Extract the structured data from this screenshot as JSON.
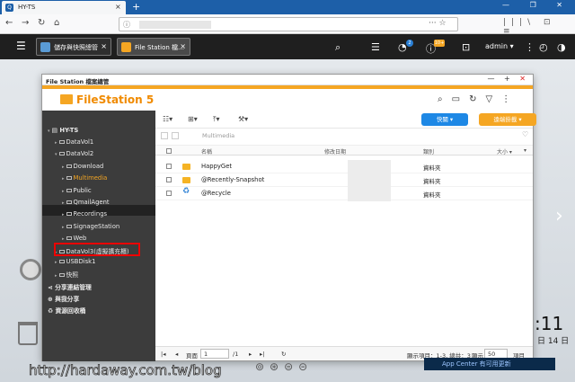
{
  "browser": {
    "tab_title": "HY-TS",
    "tab_icon": "Q",
    "tab_close": "×",
    "new_tab": "+",
    "window_controls": "— ❐ ✕",
    "url_info": "ⓘ",
    "url_dots": "··· ☆",
    "nav_right": "|||\\ ⊡ ≡"
  },
  "qts": {
    "tabs": [
      {
        "label": "儲存與快照總管",
        "close": "×"
      },
      {
        "label": "File Station 檔…",
        "close": "×"
      }
    ],
    "badges": [
      "2",
      "10+"
    ],
    "user": "admin ▾"
  },
  "window": {
    "title": "File Station 檔案總管",
    "controls": [
      "—",
      "+",
      "✕"
    ],
    "brand": "FileStation 5"
  },
  "toolbar": {
    "quick_button": "快關 ▾",
    "remote_button": "遠端掛載 ▾"
  },
  "path": {
    "current": "Multimedia",
    "heart": "♡"
  },
  "sidebar": {
    "root": "HY-TS",
    "items": [
      {
        "label": "DataVol1"
      },
      {
        "label": "DataVol2"
      },
      {
        "label": "Download"
      },
      {
        "label": "Multimedia"
      },
      {
        "label": "Public"
      },
      {
        "label": "QmailAgent"
      },
      {
        "label": "Recordings"
      },
      {
        "label": "SignageStation"
      },
      {
        "label": "Web"
      },
      {
        "label": "DataVol3(虛擬擴充櫃)"
      },
      {
        "label": "USBDisk1"
      },
      {
        "label": "快照"
      },
      {
        "label": "分享連結管理"
      },
      {
        "label": "與我分享"
      },
      {
        "label": "資源回收桶"
      }
    ]
  },
  "table": {
    "headers": [
      "名稱",
      "修改日期",
      "類別",
      "大小 ▾"
    ],
    "rows": [
      {
        "name": "HappyGet",
        "type": "資料夾"
      },
      {
        "name": "@Recently-Snapshot",
        "type": "資料夾"
      },
      {
        "name": "@Recycle",
        "type": "資料夾"
      }
    ]
  },
  "footer": {
    "page_label": "頁面",
    "page_value": "1",
    "page_total": "/1",
    "range": "顯示項目：1-3, 總共：3",
    "show_label": "顯示",
    "per_page": "50",
    "items_label": "項目"
  },
  "desktop": {
    "clock": ":11",
    "date": "日 14 日",
    "notification": "App Center 有可用更新",
    "watermark": "http://hardaway.com.tw/blog"
  },
  "colors": {
    "accent": "#f5a623",
    "quick_button": "#1e88e5",
    "highlight_box": "#e00000",
    "sidebar_bg": "#3c3c3c"
  }
}
